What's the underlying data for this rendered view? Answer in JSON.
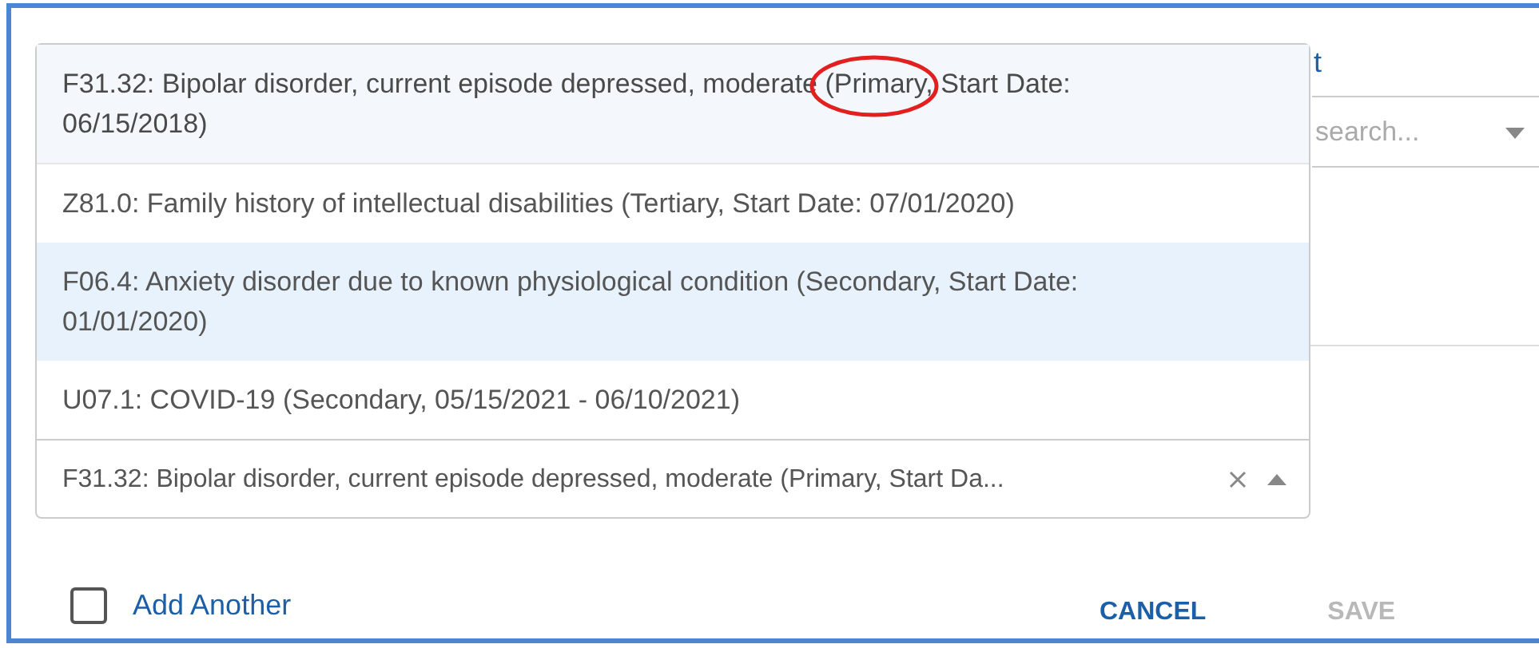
{
  "background": {
    "link_fragment": "t",
    "search": {
      "placeholder": "search..."
    }
  },
  "dropdown": {
    "options": [
      {
        "label": "F31.32: Bipolar disorder, current episode depressed, moderate (Primary, Start Date: 06/15/2018)",
        "selected": true,
        "hovered": false
      },
      {
        "label": "Z81.0: Family history of intellectual disabilities (Tertiary, Start Date: 07/01/2020)",
        "selected": false,
        "hovered": false
      },
      {
        "label": "F06.4: Anxiety disorder due to known physiological condition (Secondary, Start Date: 01/01/2020)",
        "selected": false,
        "hovered": true
      },
      {
        "label": "U07.1: COVID-19 (Secondary, 05/15/2021 - 06/10/2021)",
        "selected": false,
        "hovered": false
      }
    ],
    "value": "F31.32: Bipolar disorder, current episode depressed, moderate (Primary, Start Da...",
    "clearable": true,
    "open": true
  },
  "add_another": {
    "label": "Add Another",
    "checked": false
  },
  "buttons": [
    {
      "label": "CANCEL",
      "disabled": false
    },
    {
      "label": "SAVE",
      "disabled": true
    }
  ]
}
